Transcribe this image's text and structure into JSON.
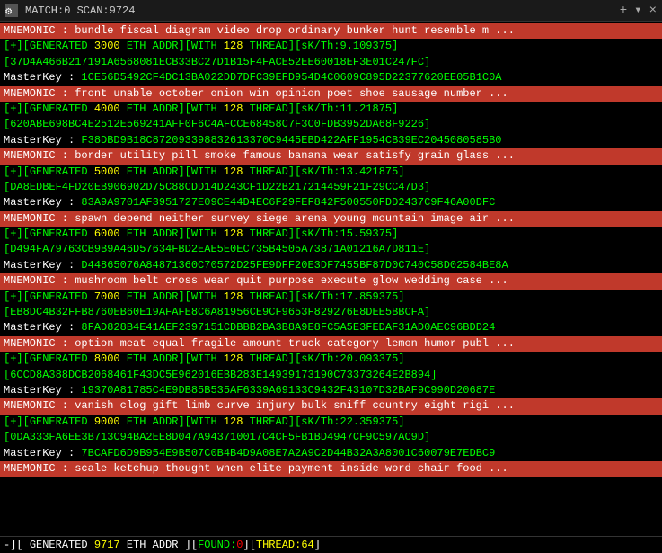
{
  "titleBar": {
    "icon": "app-icon",
    "title": "MATCH:0 SCAN:9724",
    "close": "×",
    "plus": "+",
    "arrow": "▾"
  },
  "lines": [
    {
      "type": "mnemonic",
      "text": "MNEMONIC : bundle fiscal diagram video drop ordinary bunker hunt resemble m ..."
    },
    {
      "type": "generated",
      "num": "3000",
      "label": "ETH ADDR",
      "thread": "128",
      "sk": "9.109375",
      "addr": "37D4A466B217191A6568081ECB33BC27D1B15F4FACE52EE60018EF3E01C247FC"
    },
    {
      "type": "masterkey",
      "label": "MasterKey",
      "value": "1CE56D5492CF4DC13BA022DD7DFC39EFD954D4C0609C895D22377620EE05B1C0A"
    },
    {
      "type": "mnemonic",
      "text": "MNEMONIC : front unable october onion win opinion poet shoe sausage number ..."
    },
    {
      "type": "generated",
      "num": "4000",
      "label": "ETH ADDR",
      "thread": "128",
      "sk": "11.21875",
      "addr": "620ABE698BC4E2512E569241AFF0F6C4AFCCE68458C7F3C0FDB3952DA68F9226"
    },
    {
      "type": "masterkey",
      "label": "MasterKey",
      "value": "F38DBD9B18C872093398832613370C9445EBD422AFF1954CB39EC2045080585B0"
    },
    {
      "type": "mnemonic",
      "text": "MNEMONIC : border utility pill smoke famous banana wear satisfy grain glass ..."
    },
    {
      "type": "generated",
      "num": "5000",
      "label": "ETH ADDR",
      "thread": "128",
      "sk": "13.421875",
      "addr": "DA8EDBEF4FD20EB906902D75C88CDD14D243CF1D22B217214459F21F29CC47D3"
    },
    {
      "type": "masterkey",
      "label": "MasterKey",
      "value": "83A9A9701AF3951727E09CE44D4EC6F29FEF842F500550FDD2437C9F46A00DFC"
    },
    {
      "type": "mnemonic",
      "text": "MNEMONIC : spawn depend neither survey siege arena young mountain image air ..."
    },
    {
      "type": "generated",
      "num": "6000",
      "label": "ETH ADDR",
      "thread": "128",
      "sk": "15.59375",
      "addr": "D494FA79763CB9B9A46D57634FBD2EAE5E0EC735B4505A73871A01216A7D811E"
    },
    {
      "type": "masterkey",
      "label": "MasterKey",
      "value": "D44865076A84871360C70572D25FE9DFF20E3DF7455BF87D0C740C58D02584BE8A"
    },
    {
      "type": "mnemonic",
      "text": "MNEMONIC : mushroom belt cross wear quit purpose execute glow wedding case ..."
    },
    {
      "type": "generated",
      "num": "7000",
      "label": "ETH ADDR",
      "thread": "128",
      "sk": "17.859375",
      "addr": "EB8DC4B32FFB8760EB60E19AFAFE8C6A81956CE9CF9653F829276E8DEE5BBCFA"
    },
    {
      "type": "masterkey",
      "label": "MasterKey",
      "value": "8FAD828B4E41AEF2397151CDBBB2BA3B8A9E8FC5A5E3FEDAF31AD0AEC96BDD24"
    },
    {
      "type": "mnemonic",
      "text": "MNEMONIC : option meat equal fragile amount truck category lemon humor publ ..."
    },
    {
      "type": "generated",
      "num": "8000",
      "label": "ETH ADDR",
      "thread": "128",
      "sk": "20.093375",
      "addr": "6CCD8A388DCB2068461F43DC5E962016EBB283E14939173190C73373264E2B894"
    },
    {
      "type": "masterkey",
      "label": "MasterKey",
      "value": "19370A81785C4E9DB85B535AF6339A69133C9432F43107D32BAF9C990D20687E"
    },
    {
      "type": "mnemonic",
      "text": "MNEMONIC : vanish clog gift limb curve injury bulk sniff country eight rigi ..."
    },
    {
      "type": "generated",
      "num": "9000",
      "label": "ETH ADDR",
      "thread": "128",
      "sk": "22.359375",
      "addr": "0DA333FA6EE3B713C94BA2EE8D047A943710017C4CF5FB1BD4947CF9C597AC9D"
    },
    {
      "type": "masterkey",
      "label": "MasterKey",
      "value": "7BCAFD6D9B954E9B507C0B4B4D9A08E7A2A9C2D44B32A3A8001C60079E7EDBC9"
    },
    {
      "type": "mnemonic",
      "text": "MNEMONIC : scale ketchup thought when elite payment inside word chair food ..."
    }
  ],
  "bottomBar": {
    "prefix": "-][",
    "label": "GENERATED",
    "scan": "9717",
    "ethLabel": "ETH ADDR",
    "foundLabel": "FOUND:",
    "foundVal": "0",
    "threadLabel": "THREAD:",
    "threadVal": "64"
  }
}
